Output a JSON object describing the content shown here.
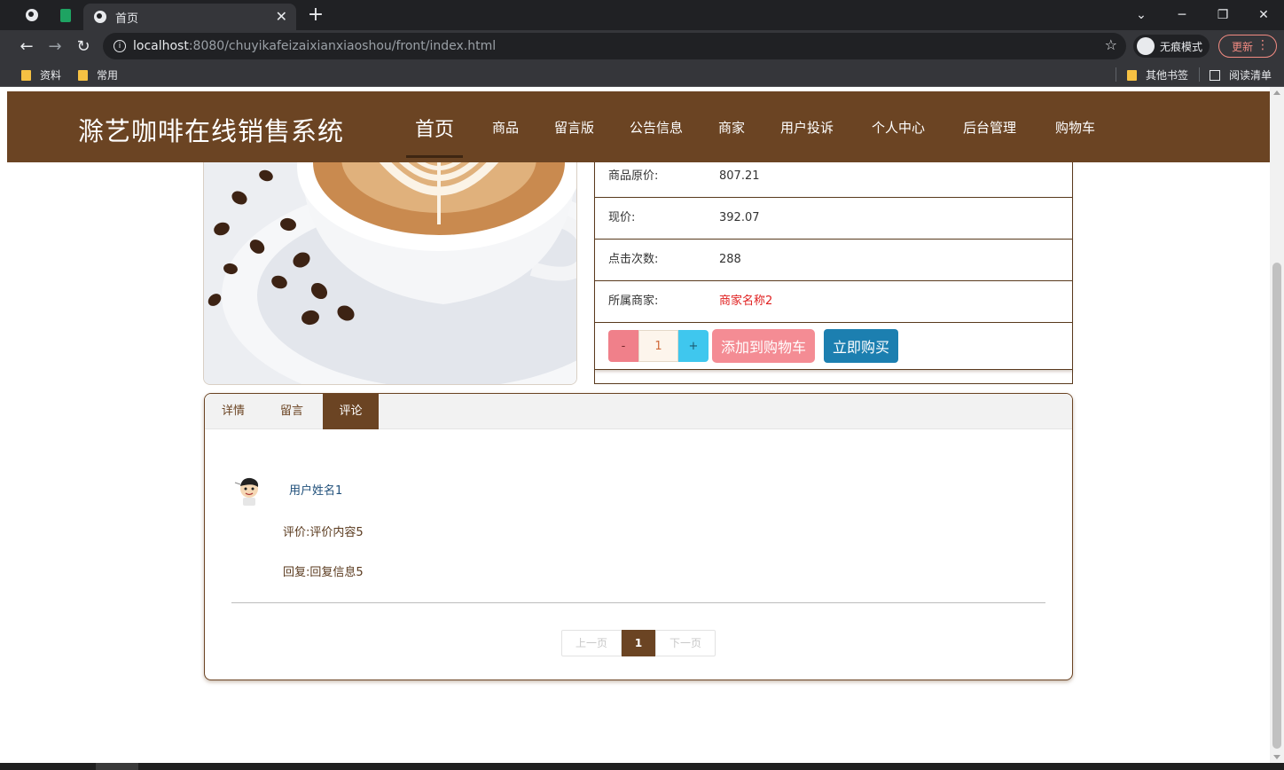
{
  "browser": {
    "active_tab_title": "首页",
    "new_tab_symbol": "+",
    "close_symbol": "✕",
    "url_host": "localhost",
    "url_rest": ":8080/chuyikafeizaixianxiaoshou/front/index.html",
    "incognito_label": "无痕模式",
    "update_label": "更新",
    "bookmarks": [
      "资料",
      "常用"
    ],
    "other_bookmarks": "其他书签",
    "reading_list": "阅读清单"
  },
  "site": {
    "title": "滁艺咖啡在线销售系统",
    "nav": [
      "首页",
      "商品",
      "留言版",
      "公告信息",
      "商家",
      "用户投诉",
      "个人中心",
      "后台管理",
      "购物车"
    ],
    "active_nav": "首页"
  },
  "product": {
    "rows": [
      {
        "label": "商品原价:",
        "value": "807.21"
      },
      {
        "label": "现价:",
        "value": "392.07"
      },
      {
        "label": "点击次数:",
        "value": "288"
      },
      {
        "label": "所属商家:",
        "value": "商家名称2"
      }
    ],
    "qty_minus": "-",
    "quantity": "1",
    "qty_plus": "+",
    "add_to_cart": "添加到购物车",
    "buy_now": "立即购买"
  },
  "tabs": {
    "items": [
      "详情",
      "留言",
      "评论"
    ],
    "active": "评论"
  },
  "review": {
    "user": "用户姓名1",
    "content": "评价:评价内容5",
    "reply": "回复:回复信息5"
  },
  "pager": {
    "prev": "上一页",
    "current": "1",
    "next": "下一页"
  },
  "colors": {
    "brand": "#6b4423",
    "danger": "#e02020",
    "cart_button": "#f48c94",
    "buy_button": "#1c7fb0"
  }
}
